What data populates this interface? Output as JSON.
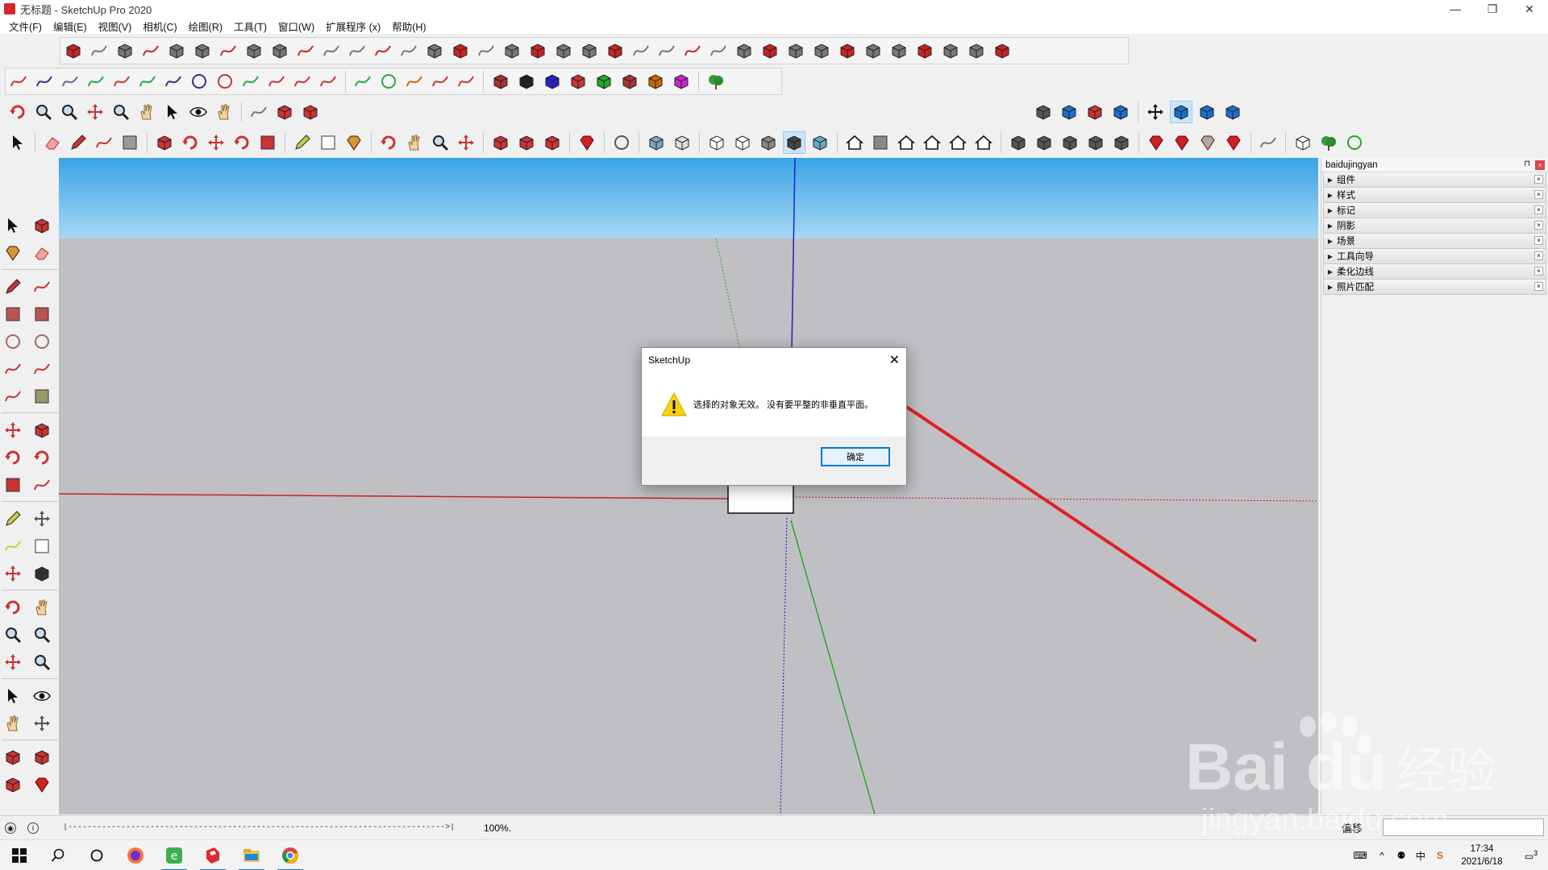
{
  "window": {
    "title": "无标题 - SketchUp Pro 2020",
    "controls": [
      "—",
      "❐",
      "✕"
    ]
  },
  "menu": [
    "文件(F)",
    "编辑(E)",
    "视图(V)",
    "相机(C)",
    "绘图(R)",
    "工具(T)",
    "窗口(W)",
    "扩展程序 (x)",
    "帮助(H)"
  ],
  "tray": {
    "title": "baidujingyan",
    "pin": "⊓",
    "close": "×",
    "panels": [
      "组件",
      "样式",
      "标记",
      "阴影",
      "场景",
      "工具向导",
      "柔化边线",
      "照片匹配"
    ]
  },
  "statusbar": {
    "progress": "|------------------------------------------------------------------------------>|",
    "zoom": "100%.",
    "measure_label": "偏移"
  },
  "dialog": {
    "title": "SketchUp",
    "close": "✕",
    "message": "选择的对象无效。 没有要平整的非垂直平面。",
    "ok_label": "确定"
  },
  "taskbar": {
    "time": "17:34",
    "date": "2021/6/18",
    "ime": "中",
    "notification_count": "3"
  },
  "watermark": {
    "brand": "Bai",
    "brand2": "du",
    "cn": "经验",
    "url": "jingyan.baidu.com"
  },
  "colors": {
    "axis_red": "#cc1f1f",
    "axis_green": "#2ea52e",
    "axis_blue": "#2020c8",
    "sky_top": "#45a9e6",
    "ground": "#bfbfc4",
    "arrow": "#e02020",
    "accent": "#0078d7"
  }
}
